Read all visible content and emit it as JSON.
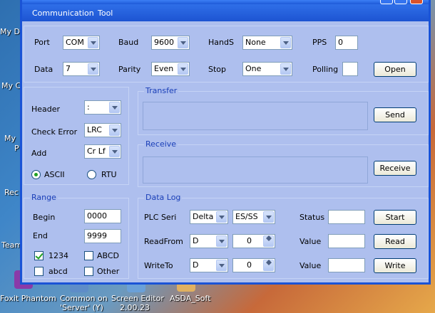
{
  "desktop": {
    "icons_left": [
      "My D",
      "My C",
      "My",
      "P",
      "Rec",
      "Team"
    ],
    "bottom_icons": [
      {
        "line1": "Foxit Phantom",
        "line2": ""
      },
      {
        "line1": "Common on",
        "line2": "'Server' (Y)"
      },
      {
        "line1": "Screen Editor",
        "line2": "2.00.23"
      },
      {
        "line1": "ASDA_Soft",
        "line2": ""
      }
    ]
  },
  "menu": {
    "communication": "Communication",
    "tool": "Tool"
  },
  "port_panel": {
    "port_label": "Port",
    "port_value": "COM",
    "baud_label": "Baud",
    "baud_value": "9600",
    "hands_label": "HandS",
    "hands_value": "None",
    "pps_label": "PPS",
    "pps_value": "0",
    "data_label": "Data",
    "data_value": "7",
    "parity_label": "Parity",
    "parity_value": "Even",
    "stop_label": "Stop",
    "stop_value": "One",
    "polling_label": "Polling",
    "polling_value": "",
    "open_button": "Open"
  },
  "format_panel": {
    "header_label": "Header",
    "header_value": ":",
    "check_error_label": "Check Error",
    "check_error_value": "LRC",
    "add_label": "Add",
    "add_value": "Cr Lf",
    "ascii_label": "ASCII",
    "rtu_label": "RTU",
    "selected_mode": "ASCII"
  },
  "transfer": {
    "title": "Transfer",
    "send_button": "Send"
  },
  "receive": {
    "title": "Receive",
    "receive_button": "Receive"
  },
  "range": {
    "title": "Range",
    "begin_label": "Begin",
    "begin_value": "0000",
    "end_label": "End",
    "end_value": "9999",
    "opt_1234": "1234",
    "opt_abcd_upper": "ABCD",
    "opt_abcd_lower": "abcd",
    "opt_other": "Other",
    "checked": [
      "1234"
    ]
  },
  "data_log": {
    "title": "Data Log",
    "plc_seri_label": "PLC Seri",
    "plc_value": "Delta",
    "series_value": "ES/SS",
    "status_label": "Status",
    "status_value": "",
    "start_button": "Start",
    "readfrom_label": "ReadFrom",
    "read_device": "D",
    "read_addr": "0",
    "value_label_1": "Value",
    "read_value": "",
    "read_button": "Read",
    "writeto_label": "WriteTo",
    "write_device": "D",
    "write_addr": "0",
    "value_label_2": "Value",
    "write_value": "",
    "write_button": "Write"
  }
}
